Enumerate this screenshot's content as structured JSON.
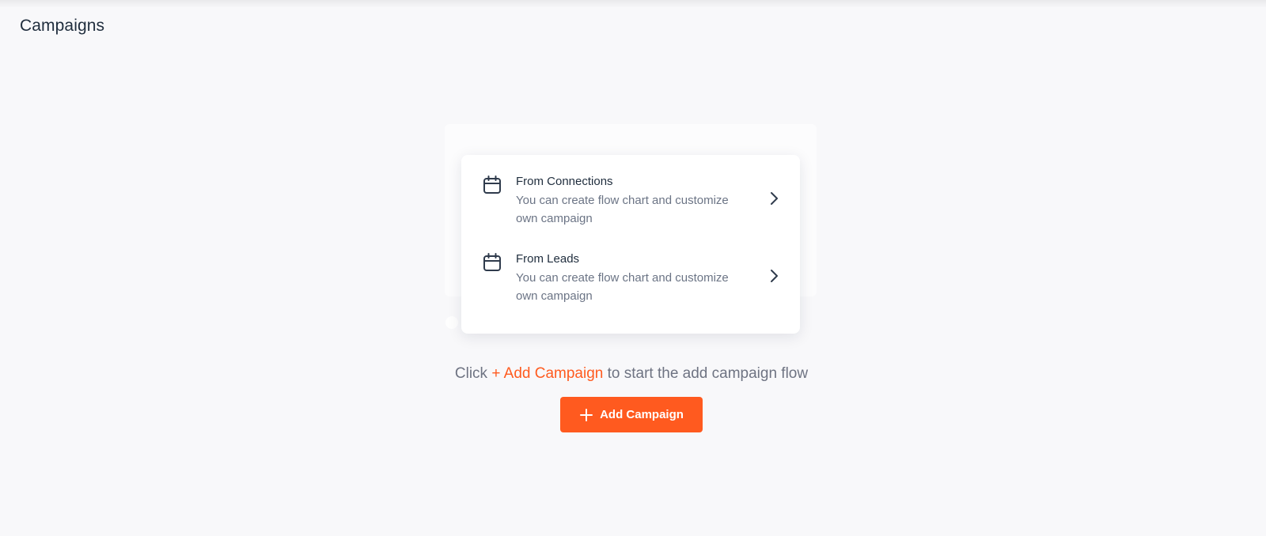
{
  "page": {
    "title": "Campaigns"
  },
  "options": [
    {
      "icon": "calendar-icon",
      "title": "From Connections",
      "description_line1": "You can create flow chart and customize",
      "description_line2": "own campaign"
    },
    {
      "icon": "calendar-icon",
      "title": "From Leads",
      "description_line1": "You can create flow chart and customize",
      "description_line2": "own campaign"
    }
  ],
  "hint": {
    "prefix": "Click ",
    "accent": "+ Add Campaign",
    "suffix": " to start the add campaign flow"
  },
  "add_button": {
    "icon": "plus-icon",
    "label": "Add Campaign"
  },
  "colors": {
    "accent": "#ff5a1f",
    "text_dark": "#1f2d3d",
    "text_muted": "#6b7485",
    "background": "#f8f8fa"
  }
}
